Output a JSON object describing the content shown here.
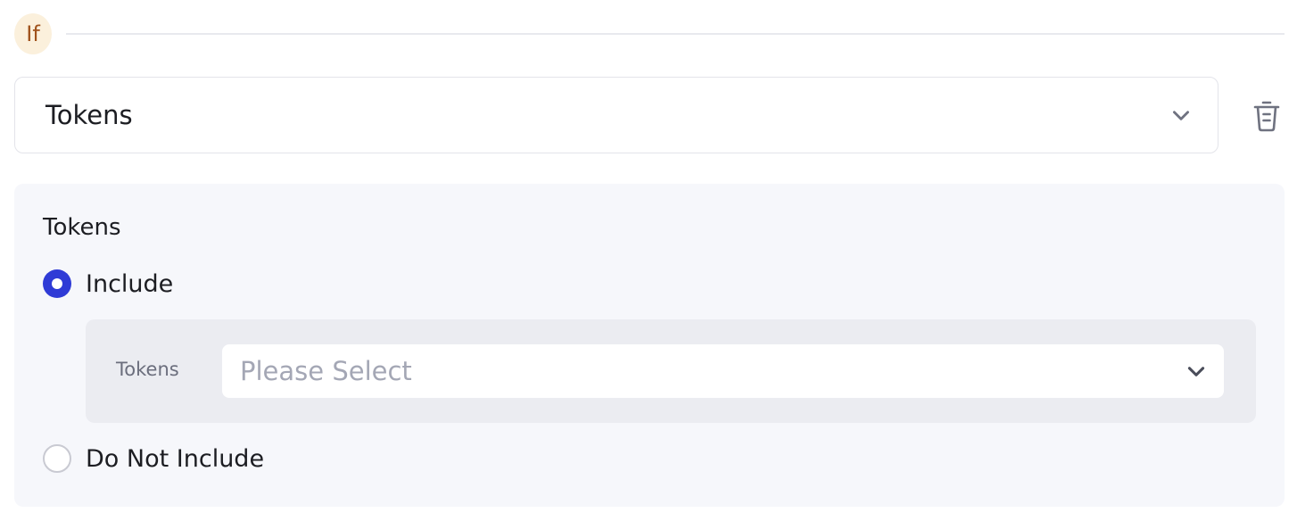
{
  "condition": {
    "badge_label": "If"
  },
  "field_select": {
    "value": "Tokens",
    "icon": "chevron-down-icon"
  },
  "delete": {
    "icon": "trash-icon"
  },
  "panel": {
    "title": "Tokens",
    "options": [
      {
        "label": "Include",
        "selected": true
      },
      {
        "label": "Do Not Include",
        "selected": false
      }
    ],
    "include_details": {
      "label": "Tokens",
      "select_placeholder": "Please Select"
    }
  },
  "colors": {
    "accent": "#2f3bd6",
    "badge_bg": "#fbf0dc",
    "badge_text": "#a0521c",
    "panel_bg": "#f6f7fb",
    "subpanel_bg": "#ebecf1"
  }
}
